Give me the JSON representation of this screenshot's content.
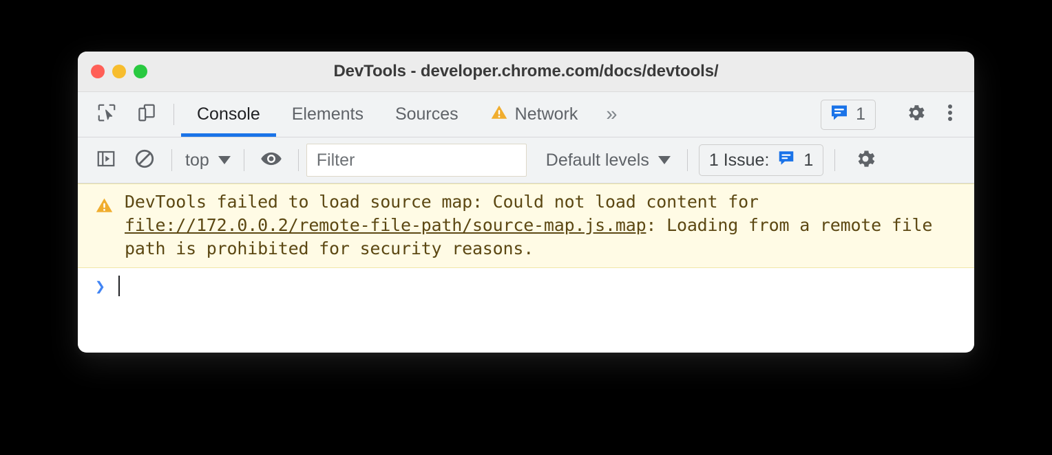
{
  "window": {
    "title": "DevTools - developer.chrome.com/docs/devtools/",
    "traffic_lights": {
      "close": "close-window",
      "minimize": "minimize-window",
      "maximize": "maximize-window"
    },
    "colors": {
      "accent_blue": "#1a73e8",
      "link_blue": "#4285f4",
      "warning_amber": "#f0ad2e",
      "warning_bg": "#fffbe5",
      "warning_text": "#5c4813",
      "toolbar_bg": "#f1f3f4",
      "titlebar_bg": "#ececec",
      "traffic_red": "#ff5f57",
      "traffic_yellow": "#f7bd2e",
      "traffic_green": "#29c940"
    }
  },
  "tabbar": {
    "inspect_icon": "inspect-cursor-icon",
    "device_icon": "device-toolbar-icon",
    "tabs": [
      {
        "label": "Console",
        "active": true,
        "warning": false
      },
      {
        "label": "Elements",
        "active": false,
        "warning": false
      },
      {
        "label": "Sources",
        "active": false,
        "warning": false
      },
      {
        "label": "Network",
        "active": false,
        "warning": true
      }
    ],
    "more_tabs_label": "»",
    "issues_count": "1",
    "settings_icon": "gear-icon",
    "more_options_icon": "kebab-menu-icon"
  },
  "console_toolbar": {
    "sidebar_toggle_icon": "console-sidebar-toggle-icon",
    "clear_console_icon": "clear-console-icon",
    "context_selector": "top",
    "eye_icon": "live-expression-eye-icon",
    "filter_placeholder": "Filter",
    "filter_value": "",
    "levels_selector": "Default levels",
    "issues_label": "1 Issue:",
    "issues_count": "1",
    "settings_icon": "console-settings-gear-icon"
  },
  "console_body": {
    "message": {
      "level": "warning",
      "icon": "warning-triangle-icon",
      "text_before": "DevTools failed to load source map: Could not load content for ",
      "link": "file://172.0.0.2/remote-file-path/source-map.js.map",
      "text_after": ": Loading from a remote file path is prohibited for security reasons."
    },
    "prompt": {
      "chevron": "❯",
      "value": ""
    }
  }
}
